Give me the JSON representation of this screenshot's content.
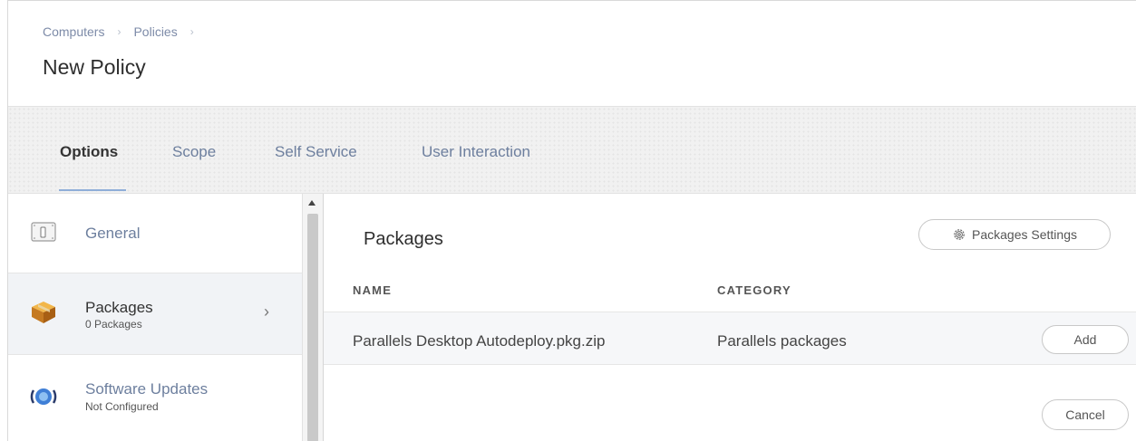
{
  "breadcrumb": {
    "items": [
      "Computers",
      "Policies"
    ],
    "separator": "›"
  },
  "page": {
    "title": "New Policy"
  },
  "tabs": [
    {
      "label": "Options",
      "active": true
    },
    {
      "label": "Scope",
      "active": false
    },
    {
      "label": "Self Service",
      "active": false
    },
    {
      "label": "User Interaction",
      "active": false
    }
  ],
  "sidebar": {
    "items": [
      {
        "label": "General",
        "sub": "",
        "icon": "switch-panel-icon"
      },
      {
        "label": "Packages",
        "sub": "0 Packages",
        "icon": "package-box-icon",
        "selected": true,
        "chevron": "›"
      },
      {
        "label": "Software Updates",
        "sub": "Not Configured",
        "icon": "software-update-globe-icon"
      }
    ]
  },
  "main": {
    "section_title": "Packages",
    "settings_button": "Packages Settings",
    "columns": {
      "name": "NAME",
      "category": "CATEGORY"
    },
    "rows": [
      {
        "name": "Parallels Desktop Autodeploy.pkg.zip",
        "category": "Parallels packages",
        "action": "Add"
      }
    ],
    "cancel_button": "Cancel"
  },
  "colors": {
    "link": "#7d8ba8",
    "tab_underline": "#8faed8",
    "selected_row": "#f1f3f6"
  }
}
